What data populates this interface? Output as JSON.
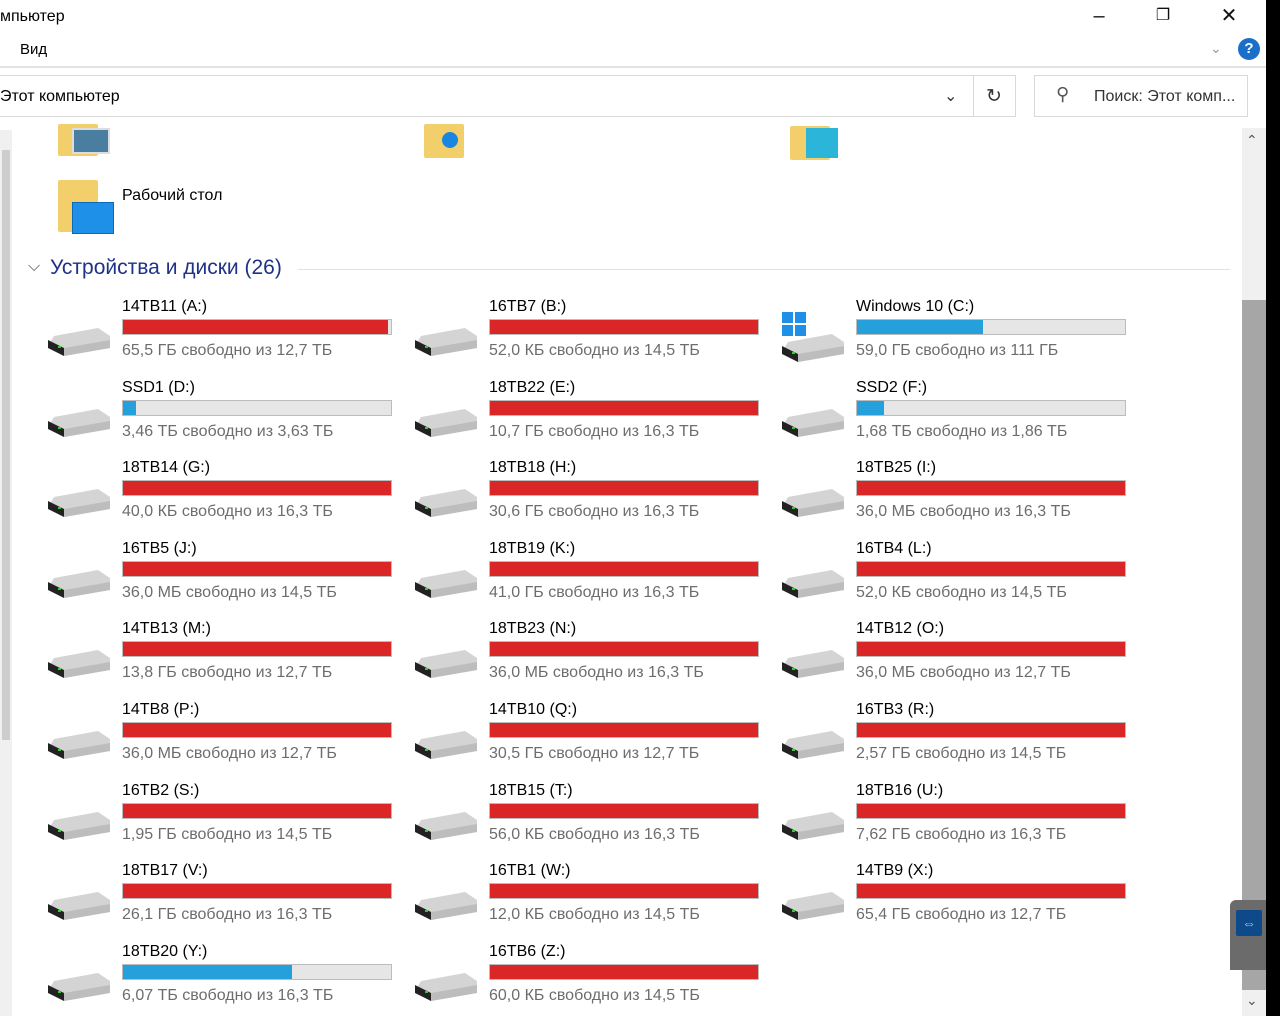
{
  "window": {
    "title": "мпьютер",
    "ribbon_tab": "Вид",
    "help": "?"
  },
  "address": {
    "path": "Этот компьютер",
    "search_placeholder": "Поиск: Этот комп..."
  },
  "folders": [
    {
      "label": "Рабочий стол"
    }
  ],
  "section": {
    "title": "Устройства и диски (26)"
  },
  "colors": {
    "full": "#da2626",
    "normal": "#26a0da"
  },
  "drives": [
    {
      "name": "14TB11 (A:)",
      "free": "65,5 ГБ свободно из 12,7 ТБ",
      "used": 0.99,
      "status": "full"
    },
    {
      "name": "16TB7 (B:)",
      "free": "52,0 КБ свободно из 14,5 ТБ",
      "used": 1.0,
      "status": "full"
    },
    {
      "name": "Windows 10 (C:)",
      "free": "59,0 ГБ свободно из 111 ГБ",
      "used": 0.47,
      "status": "normal",
      "windows": true
    },
    {
      "name": "SSD1 (D:)",
      "free": "3,46 ТБ свободно из 3,63 ТБ",
      "used": 0.05,
      "status": "normal"
    },
    {
      "name": "18TB22 (E:)",
      "free": "10,7 ГБ свободно из 16,3 ТБ",
      "used": 1.0,
      "status": "full"
    },
    {
      "name": "SSD2 (F:)",
      "free": "1,68 ТБ свободно из 1,86 ТБ",
      "used": 0.1,
      "status": "normal"
    },
    {
      "name": "18TB14 (G:)",
      "free": "40,0 КБ свободно из 16,3 ТБ",
      "used": 1.0,
      "status": "full"
    },
    {
      "name": "18TB18 (H:)",
      "free": "30,6 ГБ свободно из 16,3 ТБ",
      "used": 1.0,
      "status": "full"
    },
    {
      "name": "18TB25 (I:)",
      "free": "36,0 МБ свободно из 16,3 ТБ",
      "used": 1.0,
      "status": "full"
    },
    {
      "name": "16TB5 (J:)",
      "free": "36,0 МБ свободно из 14,5 ТБ",
      "used": 1.0,
      "status": "full"
    },
    {
      "name": "18TB19 (K:)",
      "free": "41,0 ГБ свободно из 16,3 ТБ",
      "used": 1.0,
      "status": "full"
    },
    {
      "name": "16TB4 (L:)",
      "free": "52,0 КБ свободно из 14,5 ТБ",
      "used": 1.0,
      "status": "full"
    },
    {
      "name": "14TB13 (M:)",
      "free": "13,8 ГБ свободно из 12,7 ТБ",
      "used": 1.0,
      "status": "full"
    },
    {
      "name": "18TB23 (N:)",
      "free": "36,0 МБ свободно из 16,3 ТБ",
      "used": 1.0,
      "status": "full"
    },
    {
      "name": "14TB12 (O:)",
      "free": "36,0 МБ свободно из 12,7 ТБ",
      "used": 1.0,
      "status": "full"
    },
    {
      "name": "14TB8 (P:)",
      "free": "36,0 МБ свободно из 12,7 ТБ",
      "used": 1.0,
      "status": "full"
    },
    {
      "name": "14TB10 (Q:)",
      "free": "30,5 ГБ свободно из 12,7 ТБ",
      "used": 1.0,
      "status": "full"
    },
    {
      "name": "16TB3 (R:)",
      "free": "2,57 ГБ свободно из 14,5 ТБ",
      "used": 1.0,
      "status": "full"
    },
    {
      "name": "16TB2 (S:)",
      "free": "1,95 ГБ свободно из 14,5 ТБ",
      "used": 1.0,
      "status": "full"
    },
    {
      "name": "18TB15 (T:)",
      "free": "56,0 КБ свободно из 16,3 ТБ",
      "used": 1.0,
      "status": "full"
    },
    {
      "name": "18TB16 (U:)",
      "free": "7,62 ГБ свободно из 16,3 ТБ",
      "used": 1.0,
      "status": "full"
    },
    {
      "name": "18TB17 (V:)",
      "free": "26,1 ГБ свободно из 16,3 ТБ",
      "used": 1.0,
      "status": "full"
    },
    {
      "name": "16TB1 (W:)",
      "free": "12,0 КБ свободно из 14,5 ТБ",
      "used": 1.0,
      "status": "full"
    },
    {
      "name": "14TB9 (X:)",
      "free": "65,4 ГБ свободно из 12,7 ТБ",
      "used": 1.0,
      "status": "full"
    },
    {
      "name": "18TB20 (Y:)",
      "free": "6,07 ТБ свободно из 16,3 ТБ",
      "used": 0.63,
      "status": "normal"
    },
    {
      "name": "16TB6 (Z:)",
      "free": "60,0 КБ свободно из 14,5 ТБ",
      "used": 1.0,
      "status": "full"
    }
  ]
}
